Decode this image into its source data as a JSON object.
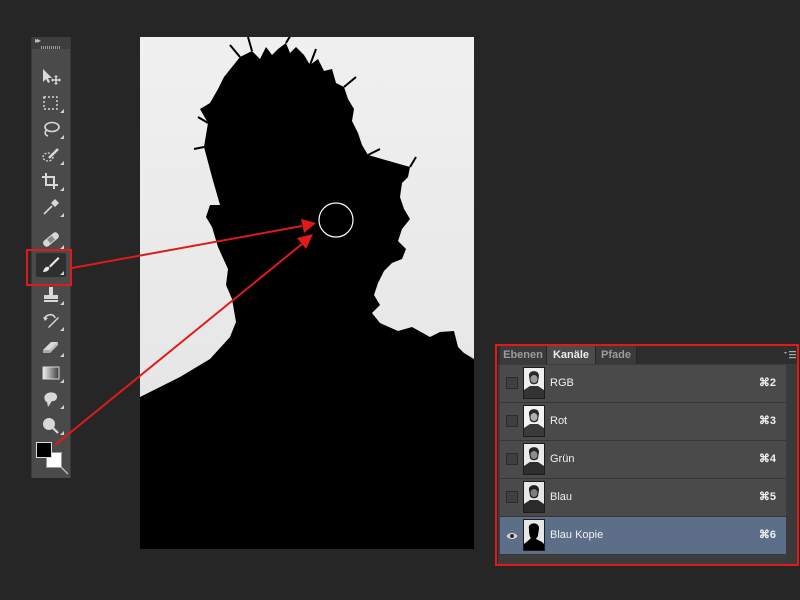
{
  "panel": {
    "tabs": [
      {
        "label": "Ebenen"
      },
      {
        "label": "Kanäle"
      },
      {
        "label": "Pfade"
      }
    ],
    "channels": [
      {
        "label": "RGB",
        "shortcut": "⌘2",
        "visible": false
      },
      {
        "label": "Rot",
        "shortcut": "⌘3",
        "visible": false
      },
      {
        "label": "Grün",
        "shortcut": "⌘4",
        "visible": false
      },
      {
        "label": "Blau",
        "shortcut": "⌘5",
        "visible": false
      },
      {
        "label": "Blau Kopie",
        "shortcut": "⌘6",
        "visible": true,
        "selected": true
      }
    ]
  },
  "toolbox": {
    "tools": [
      "move-tool-icon",
      "marquee-tool-icon",
      "lasso-tool-icon",
      "quick-selection-tool-icon",
      "crop-tool-icon",
      "eyedropper-tool-icon",
      "healing-brush-tool-icon",
      "brush-tool-icon",
      "clone-stamp-tool-icon",
      "history-brush-tool-icon",
      "eraser-tool-icon",
      "gradient-tool-icon",
      "blur-tool-icon",
      "dodge-tool-icon"
    ],
    "active_tool": "brush-tool-icon",
    "foreground_color": "#000000",
    "background_color": "#ffffff"
  },
  "colors": {
    "annotation": "#e01a1a",
    "selected_row": "#5d6f88",
    "app_background": "#262626"
  }
}
